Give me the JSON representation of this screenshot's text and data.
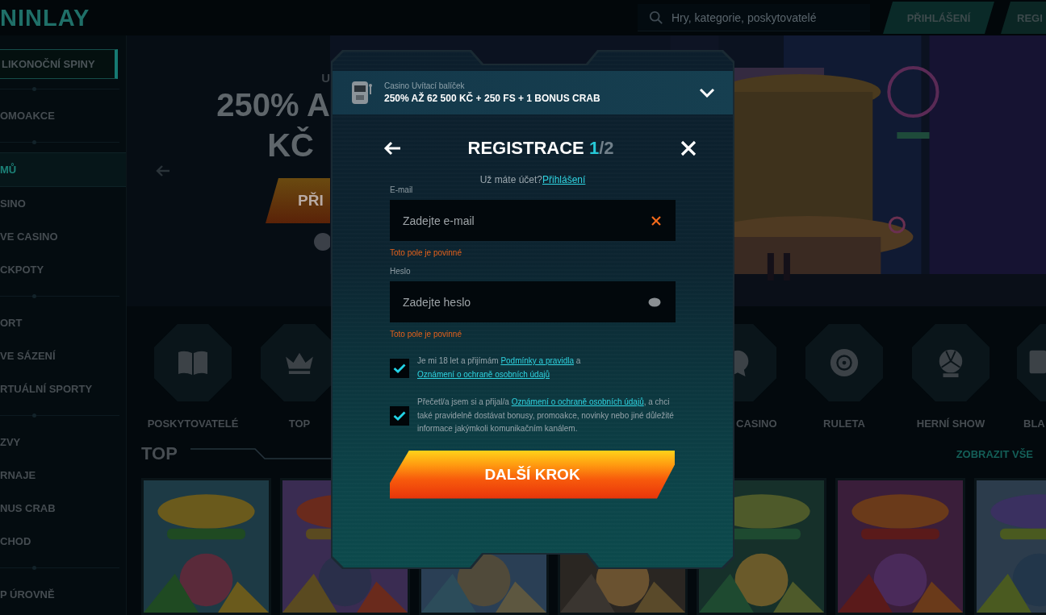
{
  "header": {
    "logo": "NINLAY",
    "search": {
      "placeholder": "Hry, kategorie, poskytovatelé"
    },
    "buttons": [
      {
        "label": "PŘIHLÁŠENÍ",
        "kind": "login"
      },
      {
        "label": "REGI",
        "kind": "register"
      }
    ]
  },
  "sidebar": {
    "promo_button": "LIKONOČNÍ SPINY",
    "groups": [
      {
        "items": [
          {
            "label": "OMOAKCE",
            "selected": false
          }
        ]
      },
      {
        "items": [
          {
            "label": "MŮ",
            "selected": true
          },
          {
            "label": "SINO",
            "selected": false
          },
          {
            "label": "VE CASINO",
            "selected": false
          },
          {
            "label": "CKPOTY",
            "selected": false
          }
        ]
      },
      {
        "items": [
          {
            "label": "ORT",
            "selected": false
          },
          {
            "label": "VE SÁZENÍ",
            "selected": false
          },
          {
            "label": "RTUÁLNÍ SPORTY",
            "selected": false
          }
        ]
      },
      {
        "items": [
          {
            "label": "ZVY",
            "selected": false
          },
          {
            "label": "RNAJE",
            "selected": false
          },
          {
            "label": "NUS CRAB",
            "selected": false
          },
          {
            "label": "CHOD",
            "selected": false
          }
        ]
      },
      {
        "items": [
          {
            "label": "P ÚROVNĚ",
            "selected": false
          }
        ]
      }
    ]
  },
  "hero": {
    "kicker": "U",
    "title_lines": [
      "250% A",
      "KČ"
    ],
    "button": "PŘI"
  },
  "categories_left": [
    {
      "label": "POSKYTOVATELÉ"
    },
    {
      "label": "TOP"
    }
  ],
  "categories_right": [
    {
      "label": "CASINO"
    },
    {
      "label": "RULETA"
    },
    {
      "label": "HERNÍ SHOW"
    },
    {
      "label": "BLA"
    }
  ],
  "top_section": {
    "title": "TOP",
    "link": "ZOBRAZIT VŠE"
  },
  "modal": {
    "bonus": {
      "caption": "Casino Uvítací balíček",
      "title": "250% AŽ 62 500 KČ + 250 FS + 1 BONUS CRAB",
      "expanded": false
    },
    "title": "REGISTRACE",
    "step": "1",
    "step_total": "/2",
    "login_prompt": "Už máte účet?",
    "login_link": "Přihlášení",
    "fields": [
      {
        "label": "E-mail",
        "placeholder": "Zadejte e-mail",
        "kind": "email",
        "error": "Toto pole je povinné"
      },
      {
        "label": "Heslo",
        "placeholder": "Zadejte heslo",
        "kind": "password",
        "error": "Toto pole je povinné"
      }
    ],
    "consents": [
      {
        "checked": true,
        "parts": [
          {
            "text": "Je mi 18 let a přijímám "
          },
          {
            "link": "Podmínky a pravidla"
          },
          {
            "text": " a "
          },
          {
            "link": "Oznámení o ochraně osobních údajů"
          }
        ]
      },
      {
        "checked": true,
        "parts": [
          {
            "text": "Přečetl/a jsem si a přijal/a "
          },
          {
            "link": "Oznámení o ochraně osobních údajů"
          },
          {
            "text": ", a chci také pravidelně dostávat bonusy, promoakce, novinky nebo jiné důležité informace jakýmkoli komunikačním kanálem."
          }
        ]
      }
    ],
    "submit": "DALŠÍ KROK"
  }
}
